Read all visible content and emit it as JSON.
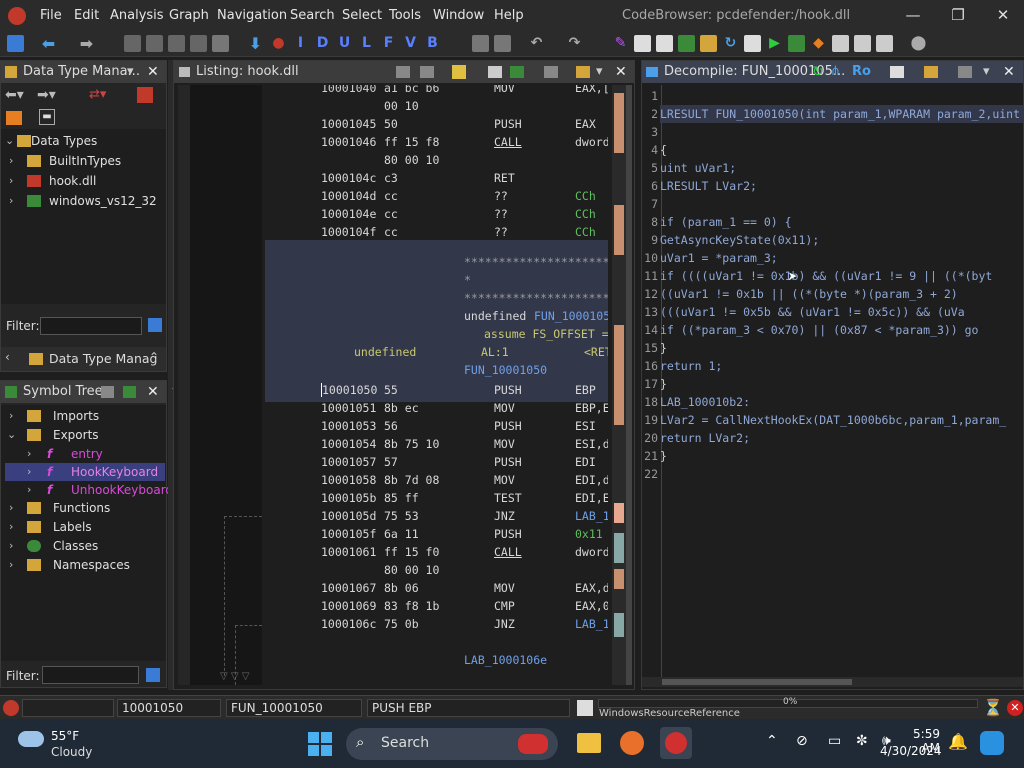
{
  "window": {
    "title": "CodeBrowser: pcdefender:/hook.dll"
  },
  "menu": [
    "File",
    "Edit",
    "Analysis",
    "Graph",
    "Navigation",
    "Search",
    "Select",
    "Tools",
    "Window",
    "Help"
  ],
  "toolbar_letters": [
    "I",
    "D",
    "U",
    "L",
    "F",
    "V",
    "B"
  ],
  "datatype_panel": {
    "title": "Data Type Mana...",
    "root": "Data Types",
    "items": [
      "BuiltInTypes",
      "hook.dll",
      "windows_vs12_32"
    ],
    "filter_label": "Filter:",
    "tab_label": "Data Type Manag"
  },
  "symbol_tree": {
    "title": "Symbol Tree",
    "imports": "Imports",
    "exports": "Exports",
    "export_items": [
      "entry",
      "HookKeyboard",
      "UnhookKeyboard"
    ],
    "others": [
      "Functions",
      "Labels",
      "Classes",
      "Namespaces"
    ],
    "filter_label": "Filter:"
  },
  "listing": {
    "title": "Listing:  hook.dll",
    "rows": [
      {
        "addr": "10001040",
        "bytes": "a1 bc b6",
        "mn": "MOV",
        "op": "EAX,["
      },
      {
        "addr": "",
        "bytes": "00 10",
        "mn": "",
        "op": ""
      },
      {
        "addr": "10001045",
        "bytes": "50",
        "mn": "PUSH",
        "op": "EAX"
      },
      {
        "addr": "10001046",
        "bytes": "ff 15 f8",
        "mn": "CALL",
        "op": "dword"
      },
      {
        "addr": "",
        "bytes": "80 00 10",
        "mn": "",
        "op": ""
      },
      {
        "addr": "1000104c",
        "bytes": "c3",
        "mn": "RET",
        "op": ""
      },
      {
        "addr": "1000104d",
        "bytes": "cc",
        "mn": "??",
        "op": "CCh"
      },
      {
        "addr": "1000104e",
        "bytes": "cc",
        "mn": "??",
        "op": "CCh"
      },
      {
        "addr": "1000104f",
        "bytes": "cc",
        "mn": "??",
        "op": "CCh"
      }
    ],
    "stars1": "*****************************",
    "star_single": "*",
    "stars2": "*****************************",
    "func_sig_type": "undefined",
    "func_sig_name": "FUN_1000105",
    "assume": "assume FS_OFFSET =",
    "ret_type": "undefined",
    "ret_loc": "AL:1",
    "ret_tag": "<RET",
    "func_label": "FUN_10001050",
    "rows2": [
      {
        "addr": "10001050",
        "bytes": "55",
        "mn": "PUSH",
        "op": "EBP"
      },
      {
        "addr": "10001051",
        "bytes": "8b ec",
        "mn": "MOV",
        "op": "EBP,E"
      },
      {
        "addr": "10001053",
        "bytes": "56",
        "mn": "PUSH",
        "op": "ESI"
      },
      {
        "addr": "10001054",
        "bytes": "8b 75 10",
        "mn": "MOV",
        "op": "ESI,d"
      },
      {
        "addr": "10001057",
        "bytes": "57",
        "mn": "PUSH",
        "op": "EDI"
      },
      {
        "addr": "10001058",
        "bytes": "8b 7d 08",
        "mn": "MOV",
        "op": "EDI,d"
      },
      {
        "addr": "1000105b",
        "bytes": "85 ff",
        "mn": "TEST",
        "op": "EDI,E"
      },
      {
        "addr": "1000105d",
        "bytes": "75 53",
        "mn": "JNZ",
        "op": "LAB_1"
      },
      {
        "addr": "1000105f",
        "bytes": "6a 11",
        "mn": "PUSH",
        "op": "0x11"
      },
      {
        "addr": "10001061",
        "bytes": "ff 15 f0",
        "mn": "CALL",
        "op": "dword"
      },
      {
        "addr": "",
        "bytes": "80 00 10",
        "mn": "",
        "op": ""
      },
      {
        "addr": "10001067",
        "bytes": "8b 06",
        "mn": "MOV",
        "op": "EAX,d"
      },
      {
        "addr": "10001069",
        "bytes": "83 f8 1b",
        "mn": "CMP",
        "op": "EAX,0"
      },
      {
        "addr": "1000106c",
        "bytes": "75 0b",
        "mn": "JNZ",
        "op": "LAB_1"
      }
    ],
    "tail_label": "LAB_1000106e"
  },
  "decompile": {
    "title": "Decompile: FUN_1000105...",
    "title_suffix": "Ro",
    "line_numbers": [
      "1",
      "2",
      "3",
      "4",
      "5",
      "6",
      "7",
      "8",
      "9",
      "10",
      "11",
      "12",
      "13",
      "14",
      "15",
      "16",
      "17",
      "18",
      "19",
      "20",
      "21",
      "22"
    ],
    "lines": [
      "",
      "LRESULT FUN_10001050(int param_1,WPARAM param_2,uint",
      "",
      "{",
      "  uint uVar1;",
      "  LRESULT LVar2;",
      "",
      "  if (param_1 == 0) {",
      "    GetAsyncKeyState(0x11);",
      "    uVar1 = *param_3;",
      "    if ((((uVar1 != 0x1b) && ((uVar1 != 9 || ((*(byt",
      "        ((uVar1 != 0x1b || ((*(byte *)(param_3 + 2)",
      "       (((uVar1 != 0x5b && (uVar1 != 0x5c)) && (uVa",
      "      if ((*param_3 < 0x70) || (0x87 < *param_3)) go",
      "    }",
      "    return 1;",
      "  }",
      "LAB_100010b2:",
      "  LVar2 = CallNextHookEx(DAT_1000b6bc,param_1,param_",
      "  return LVar2;",
      "}",
      ""
    ]
  },
  "status": {
    "address": "10001050",
    "function": "FUN_10001050",
    "instruction": "PUSH EBP",
    "progress": "0%",
    "progress_fraction": 0,
    "reference": "WindowsResourceReference"
  },
  "taskbar": {
    "temp": "55°F",
    "weather": "Cloudy",
    "search": "Search",
    "time": "5:59 AM",
    "date": "4/30/2024"
  }
}
